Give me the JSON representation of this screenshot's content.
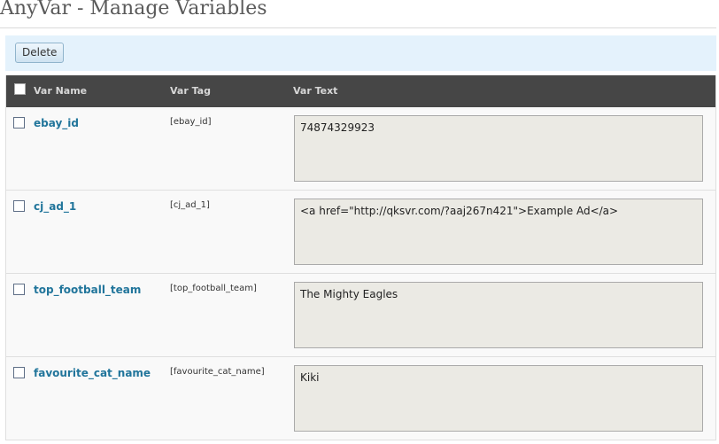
{
  "header": {
    "title": "AnyVar - Manage Variables"
  },
  "actions": {
    "delete_label": "Delete"
  },
  "table": {
    "columns": {
      "name": "Var Name",
      "tag": "Var Tag",
      "text": "Var Text"
    },
    "rows": [
      {
        "name": "ebay_id",
        "tag": "[ebay_id]",
        "text": "74874329923",
        "checked": false
      },
      {
        "name": "cj_ad_1",
        "tag": "[cj_ad_1]",
        "text": "<a href=\"http://qksvr.com/?aaj267n421\">Example Ad</a>",
        "checked": false
      },
      {
        "name": "top_football_team",
        "tag": "[top_football_team]",
        "text": "The Mighty Eagles",
        "checked": false
      },
      {
        "name": "favourite_cat_name",
        "tag": "[favourite_cat_name]",
        "text": "Kiki",
        "checked": false
      }
    ]
  },
  "colors": {
    "header_bg": "#464646",
    "link": "#21759b",
    "action_bar_bg": "#e4f2fc",
    "textarea_bg": "#ebeae4"
  }
}
